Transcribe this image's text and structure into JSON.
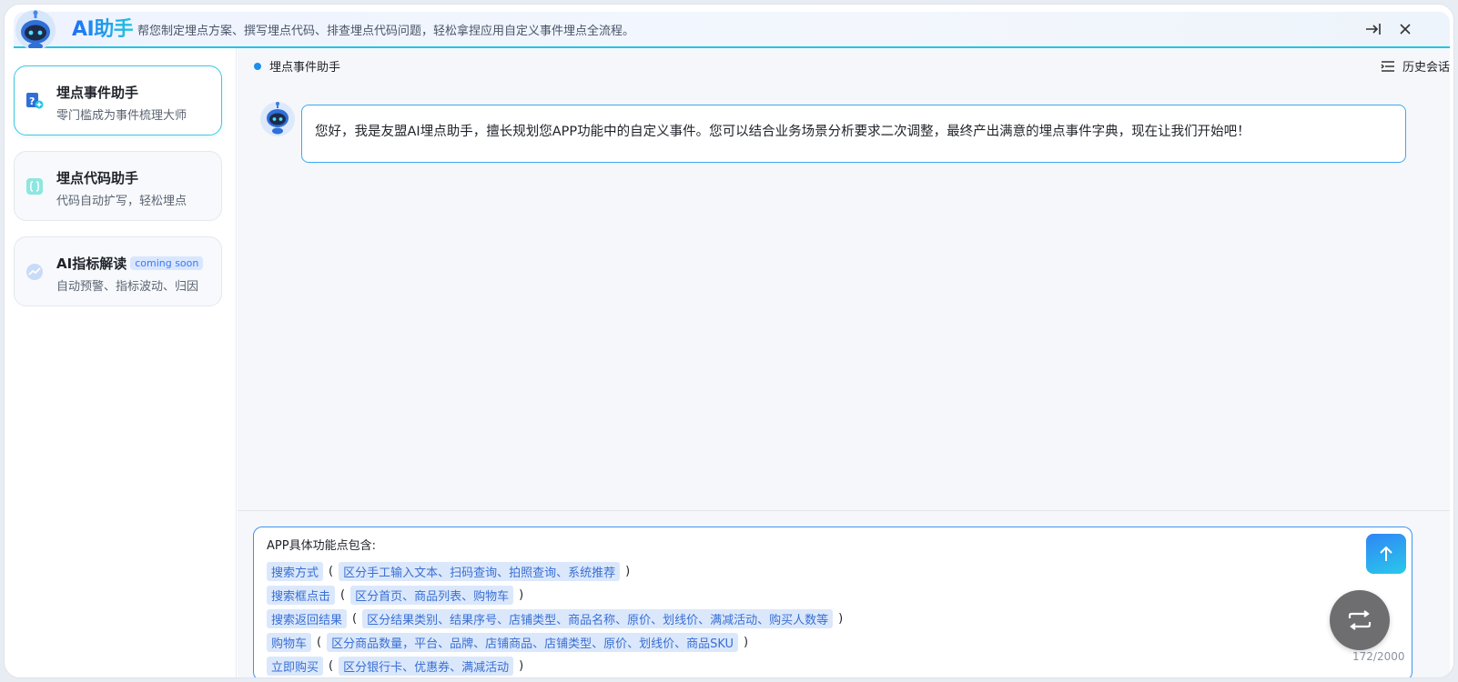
{
  "header": {
    "brand": "AI助手",
    "subtitle": "帮您制定埋点方案、撰写埋点代码、排查埋点代码问题，轻松拿捏应用自定义事件埋点全流程。",
    "collapse_icon": "collapse-right-icon",
    "close_icon": "close-icon"
  },
  "sidebar": {
    "cards": [
      {
        "title": "埋点事件助手",
        "desc": "零门槛成为事件梳理大师",
        "icon": "event-helper-icon",
        "active": true
      },
      {
        "title": "埋点代码助手",
        "desc": "代码自动扩写，轻松埋点",
        "icon": "code-braces-icon",
        "active": false
      },
      {
        "title": "AI指标解读",
        "badge": "coming soon",
        "desc": "自动预警、指标波动、归因",
        "icon": "trend-chart-icon",
        "active": false
      }
    ]
  },
  "main": {
    "breadcrumb": "埋点事件助手",
    "history_label": "历史会话",
    "greeting": "您好，我是友盟AI埋点助手，擅长规划您APP功能中的自定义事件。您可以结合业务场景分析要求二次调整，最终产出满意的埋点事件字典，现在让我们开始吧！"
  },
  "input": {
    "heading": "APP具体功能点包含:",
    "lines": [
      {
        "tag": "搜索方式",
        "detail": "区分手工输入文本、扫码查询、拍照查询、系统推荐"
      },
      {
        "tag": "搜索框点击",
        "detail": "区分首页、商品列表、购物车"
      },
      {
        "tag": "搜索返回结果",
        "detail": "区分结果类别、结果序号、店铺类型、商品名称、原价、划线价、满减活动、购买人数等"
      },
      {
        "tag": "购物车",
        "detail": "区分商品数量，平台、品牌、店铺商品、店铺类型、原价、划线价、商品SKU"
      },
      {
        "tag": "立即购买",
        "detail": "区分银行卡、优惠券、满减活动"
      }
    ],
    "counter": "172/2000"
  },
  "colors": {
    "accent": "#1e8ef0",
    "cyan": "#22c6e0",
    "tag_bg": "#dbe8fb",
    "tag_text": "#3a6fd4"
  }
}
